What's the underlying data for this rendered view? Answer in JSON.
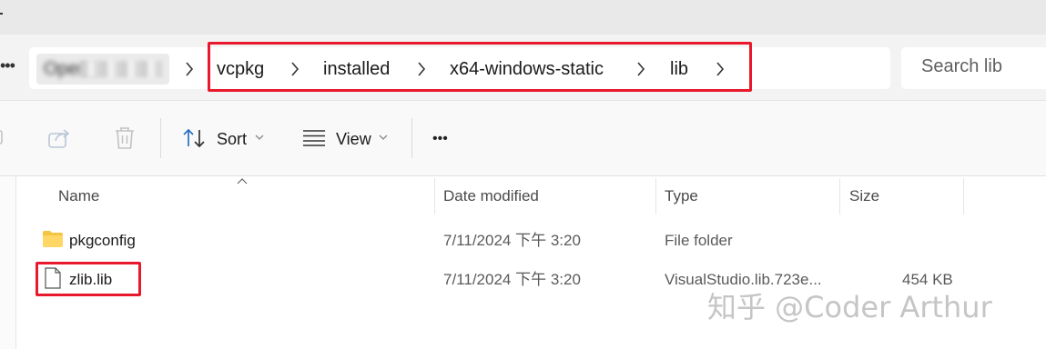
{
  "address_bar": {
    "more_label": "•••",
    "blurred_crumb": "Openc",
    "breadcrumbs": [
      "vcpkg",
      "installed",
      "x64-windows-static",
      "lib"
    ],
    "search_placeholder": "Search lib"
  },
  "toolbar": {
    "sort_label": "Sort",
    "view_label": "View",
    "more_label": "•••"
  },
  "columns": [
    "Name",
    "Date modified",
    "Type",
    "Size"
  ],
  "rows": [
    {
      "name": "pkgconfig",
      "date": "7/11/2024 下午 3:20",
      "type": "File folder",
      "size": "",
      "icon": "folder-icon"
    },
    {
      "name": "zlib.lib",
      "date": "7/11/2024 下午 3:20",
      "type": "VisualStudio.lib.723e...",
      "size": "454 KB",
      "icon": "file-icon"
    }
  ],
  "watermark": "知乎 @Coder Arthur",
  "colors": {
    "highlight": "#e8192c",
    "folder": "#f4c542"
  }
}
